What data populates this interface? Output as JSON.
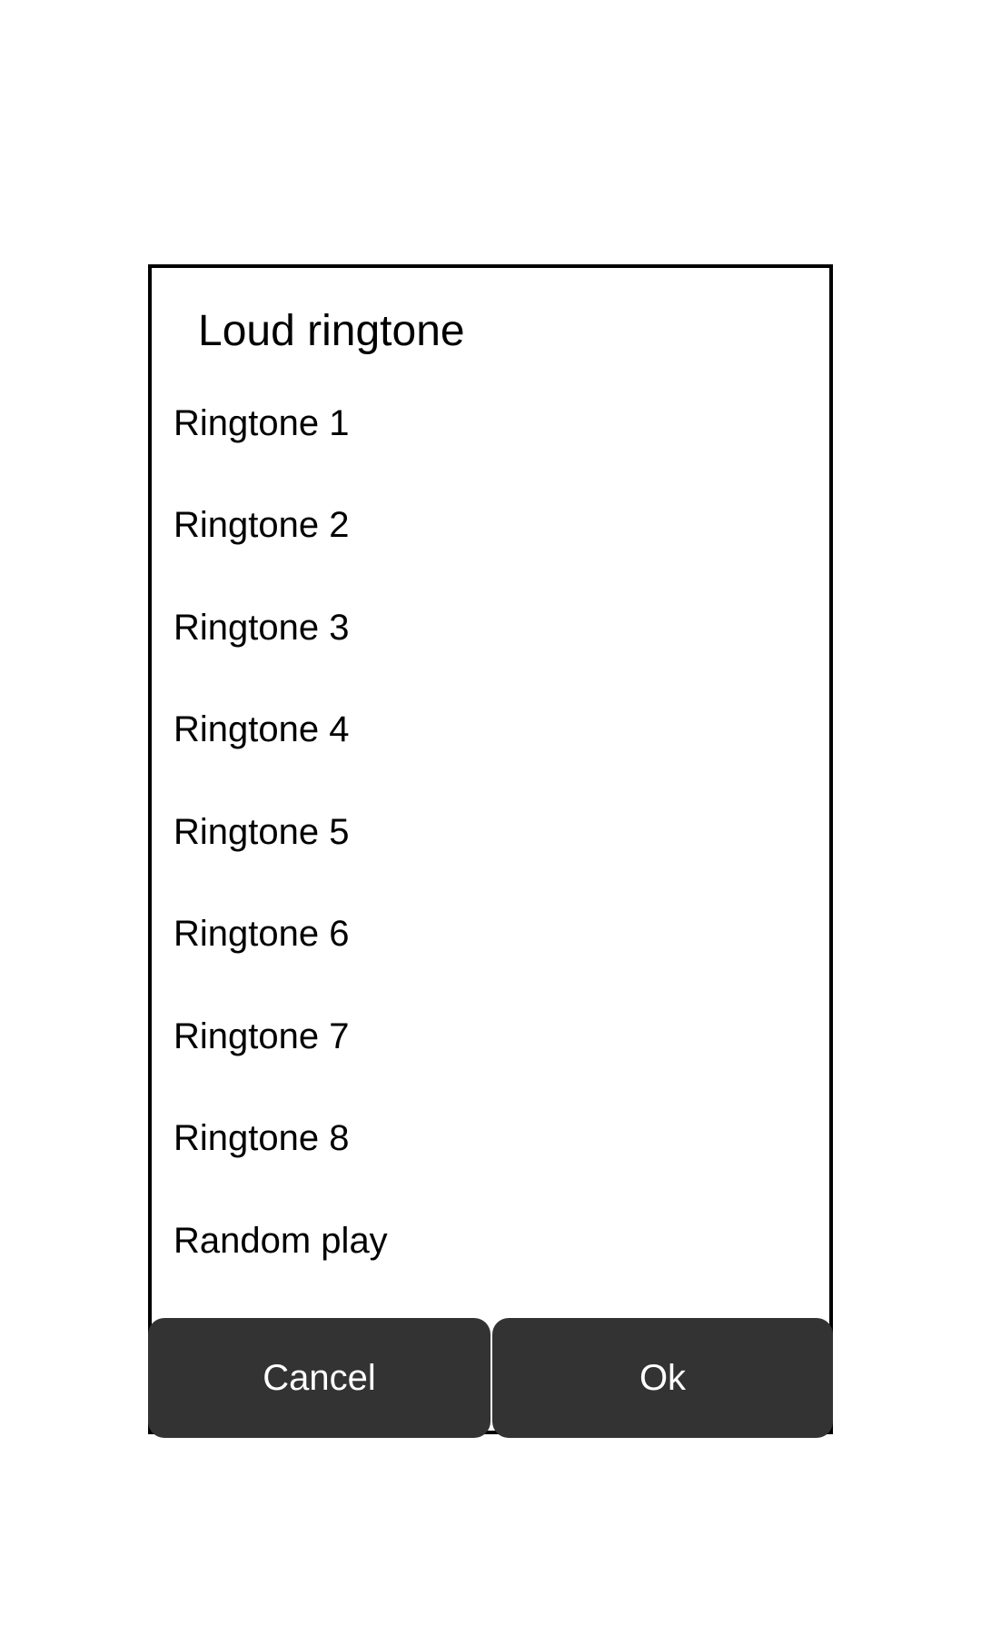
{
  "dialog": {
    "title": "Loud ringtone",
    "items": [
      {
        "label": "Ringtone 1"
      },
      {
        "label": "Ringtone 2"
      },
      {
        "label": "Ringtone 3"
      },
      {
        "label": "Ringtone 4"
      },
      {
        "label": "Ringtone 5"
      },
      {
        "label": "Ringtone 6"
      },
      {
        "label": "Ringtone 7"
      },
      {
        "label": "Ringtone 8"
      },
      {
        "label": "Random play"
      }
    ],
    "buttons": {
      "cancel_label": "Cancel",
      "ok_label": "Ok"
    }
  },
  "colors": {
    "background": "#ffffff",
    "dialog_border": "#000000",
    "button_background": "#333333",
    "button_text": "#ffffff"
  }
}
